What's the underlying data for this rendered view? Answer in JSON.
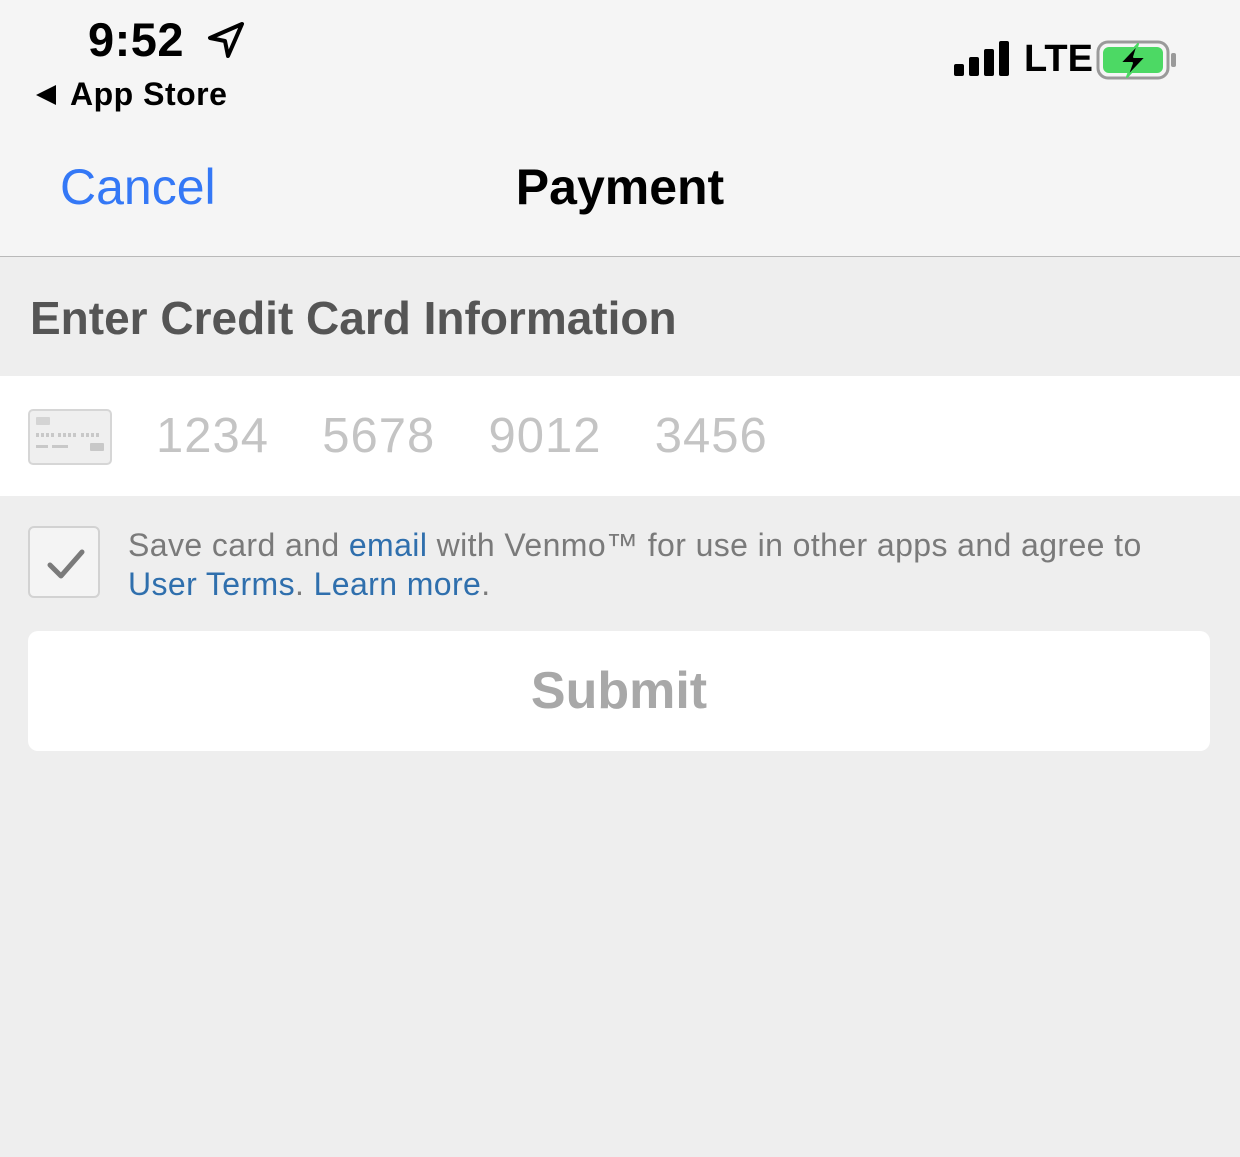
{
  "status_bar": {
    "time": "9:52",
    "location_icon": "location-arrow-icon",
    "back_label": "App Store",
    "signal_icon": "cellular-signal-icon",
    "network": "LTE",
    "battery_icon": "battery-charging-icon"
  },
  "nav": {
    "cancel_label": "Cancel",
    "title": "Payment"
  },
  "form": {
    "section_title": "Enter Credit Card Information",
    "card_icon": "credit-card-icon",
    "card_number_placeholder": "1234  5678  9012  3456",
    "card_number_value": "",
    "save_card_checked": true,
    "save_text_1": "Save card and ",
    "save_link_email": "email",
    "save_text_2": " with Venmo™ for use in other apps and agree to ",
    "save_link_terms": "User Terms",
    "save_text_3": ". ",
    "save_link_learn": "Learn more",
    "save_text_4": ".",
    "submit_label": "Submit"
  },
  "colors": {
    "accent": "#3478f6",
    "link": "#2f6fad",
    "battery_fill": "#4cd964",
    "background": "#eeeeee",
    "placeholder": "#c4c4c4"
  }
}
